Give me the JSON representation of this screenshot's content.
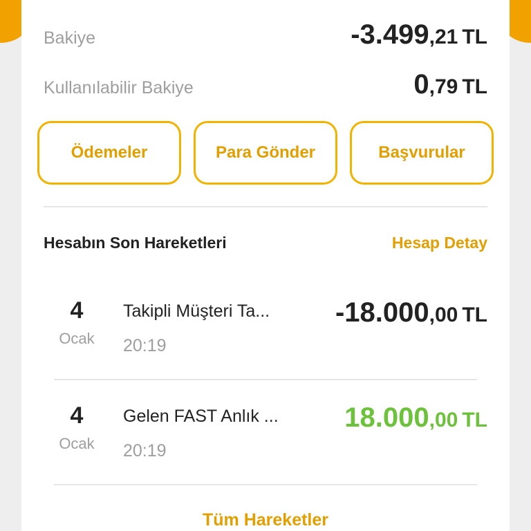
{
  "colors": {
    "accent": "#f2a200",
    "link": "#e39e00",
    "positive": "#6cc23a",
    "text": "#222222",
    "muted": "#9e9e9e"
  },
  "balance": {
    "label": "Bakiye",
    "int": "-3.499",
    "dec": ",21",
    "currency": "TL"
  },
  "available": {
    "label": "Kullanılabilir Bakiye",
    "int": "0",
    "dec": ",79",
    "currency": "TL"
  },
  "actions": [
    {
      "label": "Ödemeler"
    },
    {
      "label": "Para Gönder"
    },
    {
      "label": "Başvurular"
    }
  ],
  "recent": {
    "title": "Hesabın Son Hareketleri",
    "detail_link": "Hesap Detay",
    "transactions": [
      {
        "day": "4",
        "month": "Ocak",
        "description": "Takipli Müşteri Ta...",
        "time": "20:19",
        "int": "-18.000",
        "dec": ",00",
        "currency": "TL"
      },
      {
        "day": "4",
        "month": "Ocak",
        "description": "Gelen FAST Anlık ...",
        "time": "20:19",
        "int": "18.000",
        "dec": ",00",
        "currency": "TL"
      }
    ],
    "all_link": "Tüm Hareketler"
  }
}
